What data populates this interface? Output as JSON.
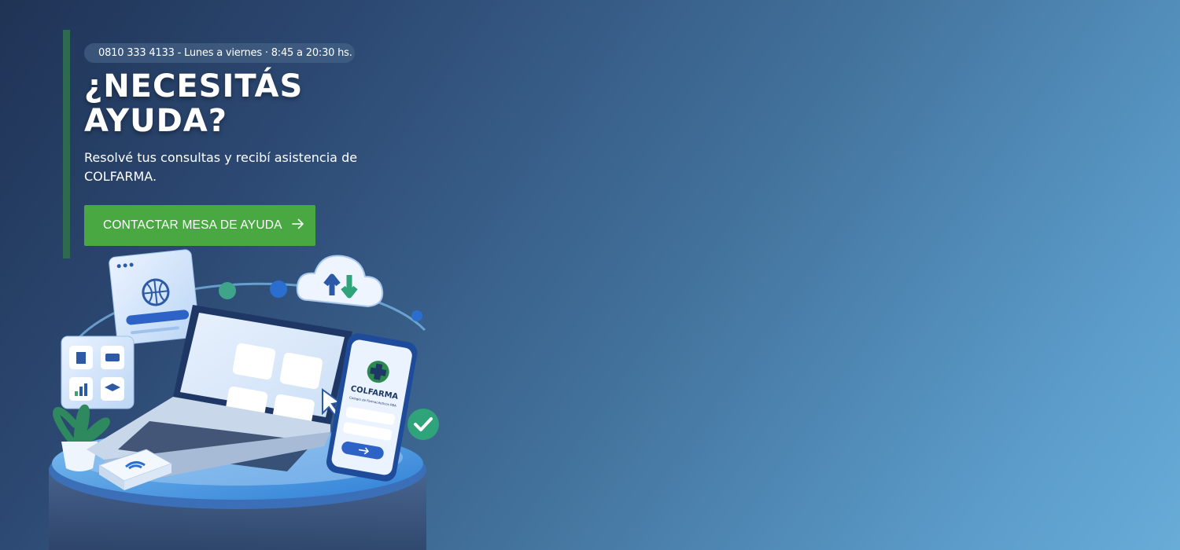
{
  "hero": {
    "contact_pill": "0810 333 4133 - Lunes a viernes · 8:45 a 20:30 hs.",
    "title_line1": "¿NECESITÁS",
    "title_line2": "AYUDA?",
    "subtitle": "Resolvé tus consultas y recibí asistencia de COLFARMA.",
    "cta_label": "CONTACTAR MESA DE AYUDA",
    "cta_icon": "arrow-right-icon"
  },
  "illustration": {
    "brand_name": "COLFARMA",
    "brand_tagline": "Colegio de Farmacéuticos PBA"
  },
  "colors": {
    "accent_green": "#4aa843",
    "accent_bar": "#2e6a4f",
    "bg_dark": "#1f3355",
    "bg_light": "#68acd8"
  }
}
